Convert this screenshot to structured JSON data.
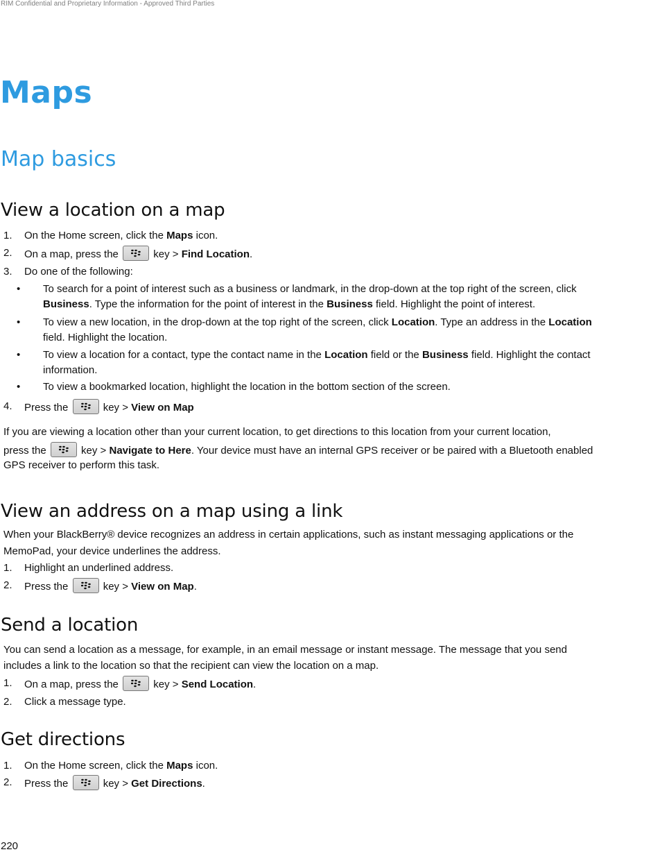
{
  "header": {
    "confidential": "RIM Confidential and Proprietary Information - Approved Third Parties"
  },
  "title": "Maps",
  "subtitle": "Map basics",
  "key_icon": "blackberry-menu-key-icon",
  "sections": {
    "view_location": {
      "heading": "View a location on a map",
      "steps": [
        {
          "num": "1.",
          "pre": "On the Home screen, click the ",
          "bold": "Maps",
          "post": " icon."
        },
        {
          "num": "2.",
          "pre": "On a map, press the ",
          "mid": " key > ",
          "bold": "Find Location",
          "post": "."
        },
        {
          "num": "3.",
          "pre": "Do one of the following:"
        },
        {
          "num": "4.",
          "pre": "Press the ",
          "mid": " key > ",
          "bold": "View on Map",
          "post": ""
        }
      ],
      "bullets": [
        {
          "l1_pre": "To search for a point of interest such as a business or landmark, in the drop-down at the top right of the screen, click",
          "l2_b1": "Business",
          "l2_t1": ". Type the information for the point of interest in the ",
          "l2_b2": "Business",
          "l2_t2": " field. Highlight the point of interest."
        },
        {
          "l1_pre": "To view a new location, in the drop-down at the top right of the screen, click ",
          "l1_b1": "Location",
          "l1_t1": ". Type an address in the ",
          "l1_b2": "Location",
          "l2": "field. Highlight the location."
        },
        {
          "l1_pre": "To view a location for a contact, type the contact name in the ",
          "l1_b1": "Location",
          "l1_t1": " field or the ",
          "l1_b2": "Business",
          "l1_t2": " field. Highlight the contact",
          "l2": "information."
        },
        {
          "l1_pre": "To view a bookmarked location, highlight the location in the bottom section of the screen."
        }
      ],
      "note": {
        "l1": "If you are viewing a location other than your current location, to get directions to this location from your current location,",
        "l2_pre": "press the ",
        "l2_mid": " key > ",
        "l2_bold": "Navigate to Here",
        "l2_post": ". Your device must have an internal GPS receiver or be paired with a Bluetooth enabled",
        "l3": "GPS receiver to perform this task."
      }
    },
    "view_address": {
      "heading": "View an address on a map using a link",
      "intro_l1": "When your BlackBerry® device recognizes an address in certain applications, such as instant messaging applications or the",
      "intro_l2": "MemoPad, your device underlines the address.",
      "steps": [
        {
          "num": "1.",
          "pre": "Highlight an underlined address."
        },
        {
          "num": "2.",
          "pre": "Press the ",
          "mid": " key > ",
          "bold": "View on Map",
          "post": "."
        }
      ]
    },
    "send_location": {
      "heading": "Send a location",
      "intro_l1": "You can send a location as a message, for example, in an email message or instant message. The message that you send",
      "intro_l2": "includes a link to the location so that the recipient can view the location on a map.",
      "steps": [
        {
          "num": "1.",
          "pre": "On a map, press the ",
          "mid": " key > ",
          "bold": "Send Location",
          "post": "."
        },
        {
          "num": "2.",
          "pre": "Click a message type."
        }
      ]
    },
    "get_directions": {
      "heading": "Get directions",
      "steps": [
        {
          "num": "1.",
          "pre": "On the Home screen, click the ",
          "bold": "Maps",
          "post": " icon."
        },
        {
          "num": "2.",
          "pre": "Press the ",
          "mid": " key > ",
          "bold": "Get Directions",
          "post": "."
        }
      ]
    }
  },
  "footer": {
    "page_number": "220"
  }
}
